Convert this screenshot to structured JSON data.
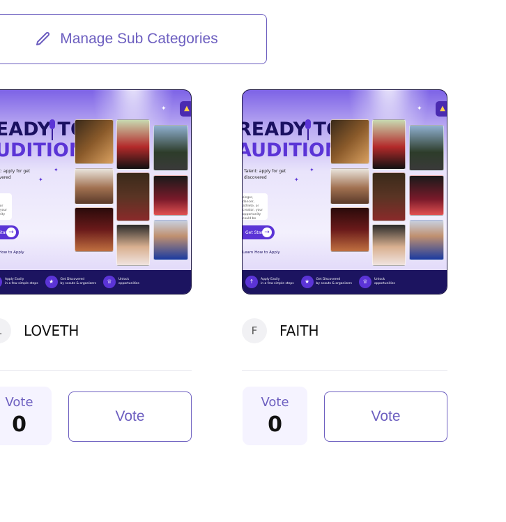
{
  "toolbar": {
    "manage_label": "Manage Sub Categories",
    "manage_icon": "pencil-icon",
    "accent": "#6d5fc0"
  },
  "banner": {
    "headline_line1": "READY TO",
    "headline_line2": "AUDITION?",
    "subtext": "Talent: apply for\nget discovered",
    "box_text": "singer, dancer,\nathlete, or creator,\nyour opportunity could be",
    "cta": "Get Started",
    "how_to": "Learn How to Apply",
    "footer": [
      {
        "icon": "upload-icon",
        "title": "Apply Easily",
        "text": "in a few simple steps"
      },
      {
        "icon": "star-icon",
        "title": "Get Discovered",
        "text": "by scouts & organizers"
      },
      {
        "icon": "trophy-icon",
        "title": "Unlock",
        "text": "opportunities"
      }
    ]
  },
  "contestants": [
    {
      "name": "LOVETH",
      "initial": "L",
      "vote_label": "Vote",
      "votes": "0",
      "vote_button": "Vote"
    },
    {
      "name": "FAITH",
      "initial": "F",
      "vote_label": "Vote",
      "votes": "0",
      "vote_button": "Vote"
    }
  ]
}
